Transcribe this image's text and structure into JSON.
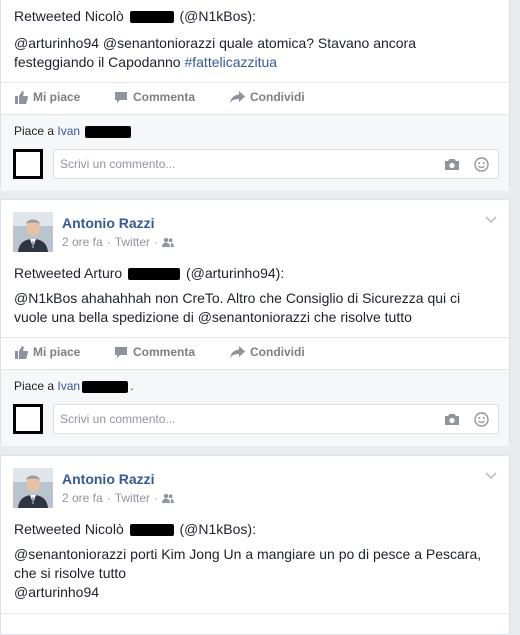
{
  "posts": [
    {
      "retweet_prefix": "Retweeted Nicolò",
      "retweet_handle": "(@N1kBos):",
      "text_part1": "@arturinho94 @senantoniorazzi quale atomica? Stavano ancora festeggiando il Capodanno ",
      "hashtag": "#fattelicazzitua",
      "likes_prefix": "Piace a",
      "likes_name": "Ivan",
      "comment_placeholder": "Scrivi un commento..."
    },
    {
      "author": "Antonio Razzi",
      "time": "2 ore fa",
      "source": "Twitter",
      "retweet_prefix": "Retweeted Arturo",
      "retweet_handle": "(@arturinho94):",
      "text": "@N1kBos ahahahhah non CreTo. Altro che Consiglio di Sicurezza qui ci vuole una bella spedizione di @senantoniorazzi che risolve tutto",
      "likes_prefix": "Piace a",
      "likes_name": "Ivan",
      "likes_suffix": ".",
      "comment_placeholder": "Scrivi un commento..."
    },
    {
      "author": "Antonio Razzi",
      "time": "2 ore fa",
      "source": "Twitter",
      "retweet_prefix": "Retweeted Nicolò",
      "retweet_handle": "(@N1kBos):",
      "text_line1": "@senantoniorazzi porti Kim Jong Un a mangiare un po di pesce a Pescara, che si risolve tutto",
      "text_line2": "@arturinho94"
    }
  ],
  "actions": {
    "like": "Mi piace",
    "comment": "Commenta",
    "share": "Condividi"
  },
  "meta_separator": "·",
  "icons": {
    "like": "thumbs-up-icon",
    "comment": "speech-bubble-icon",
    "share": "share-arrow-icon",
    "camera": "camera-icon",
    "emoji": "smiley-icon",
    "audience": "friends-icon",
    "menu": "chevron-down-icon"
  },
  "colors": {
    "link": "#365899",
    "muted": "#90949c",
    "action": "#7f7f7f",
    "background": "#e9ebee"
  }
}
